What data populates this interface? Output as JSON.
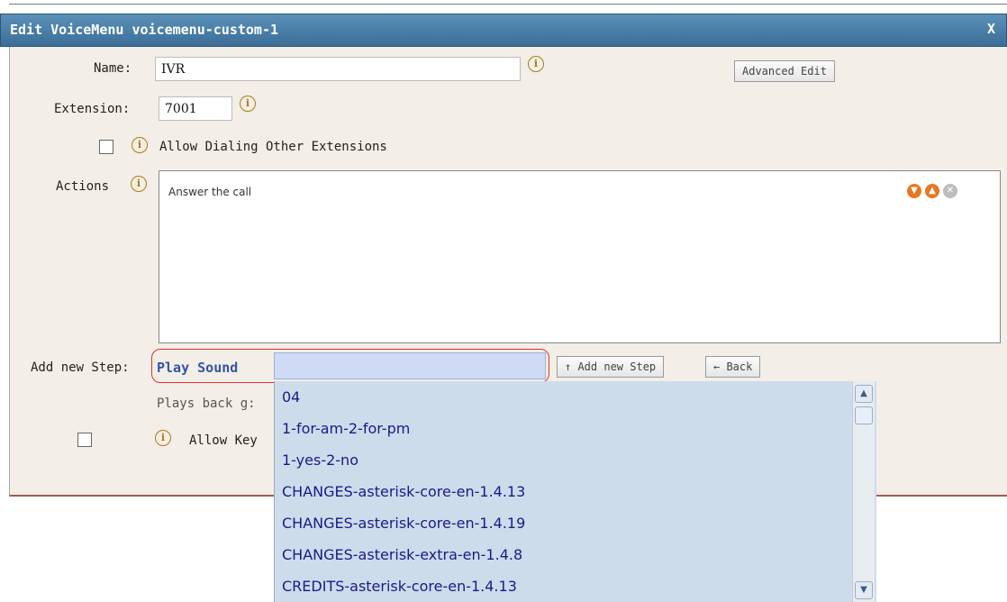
{
  "dialog": {
    "title": "Edit VoiceMenu voicemenu-custom-1",
    "close_label": "X"
  },
  "form": {
    "name_label": "Name:",
    "name_value": "IVR",
    "extension_label": "Extension:",
    "extension_value": "7001",
    "allow_dialing_label": "Allow Dialing Other Extensions",
    "actions_label": "Actions",
    "advanced_edit_label": "Advanced Edit",
    "actions_list": [
      "Answer the call"
    ],
    "add_step_label": "Add new Step:",
    "step_type": "Play Sound",
    "add_step_button": "↑ Add new Step",
    "back_button": "← Back",
    "plays_back_text": "Plays back g:",
    "allow_key_text": "Allow Key"
  },
  "dropdown": {
    "items": [
      "04",
      "1-for-am-2-for-pm",
      "1-yes-2-no",
      "CHANGES-asterisk-core-en-1.4.13",
      "CHANGES-asterisk-core-en-1.4.19",
      "CHANGES-asterisk-extra-en-1.4.8",
      "CREDITS-asterisk-core-en-1.4.13"
    ]
  },
  "icons": {
    "info": "info-icon",
    "move_down": "move-down-icon",
    "move_up": "move-up-icon",
    "delete": "delete-icon"
  },
  "colors": {
    "title_bar": "#4a80ab",
    "panel_bg": "#f3eee7",
    "dropdown_bg": "#cddcea",
    "highlight_border": "#dd3333",
    "action_icon": "#e87722"
  }
}
